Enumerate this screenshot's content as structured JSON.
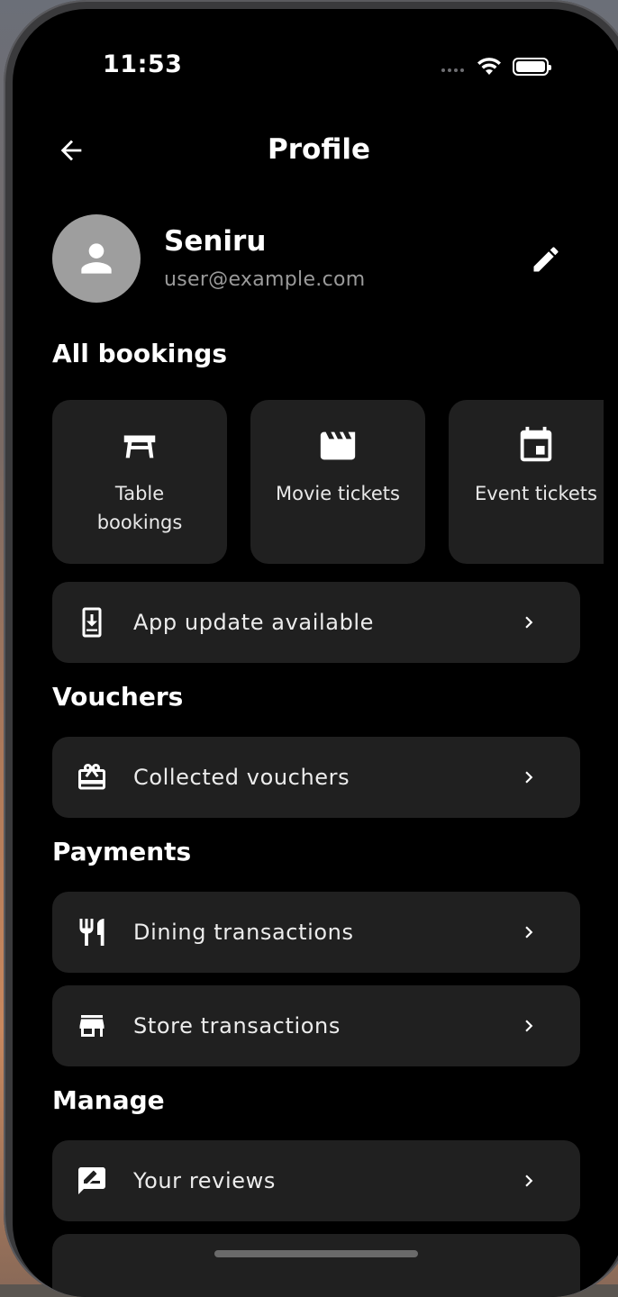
{
  "status_bar": {
    "time": "11:53"
  },
  "header": {
    "title": "Profile"
  },
  "profile": {
    "name": "Seniru",
    "email": "user@example.com"
  },
  "sections": {
    "bookings": "All bookings",
    "vouchers": "Vouchers",
    "payments": "Payments",
    "manage": "Manage"
  },
  "booking_tiles": [
    {
      "label": "Table bookings",
      "icon": "table-icon"
    },
    {
      "label": "Movie tickets",
      "icon": "movie-clapper-icon"
    },
    {
      "label": "Event tickets",
      "icon": "calendar-event-icon"
    }
  ],
  "rows": {
    "app_update": {
      "label": "App update available",
      "icon": "phone-download-icon"
    },
    "collected_vouchers": {
      "label": "Collected vouchers",
      "icon": "gift-card-icon"
    },
    "dining_transactions": {
      "label": "Dining transactions",
      "icon": "fork-knife-icon"
    },
    "store_transactions": {
      "label": "Store transactions",
      "icon": "storefront-icon"
    },
    "your_reviews": {
      "label": "Your reviews",
      "icon": "rate-review-icon"
    }
  }
}
